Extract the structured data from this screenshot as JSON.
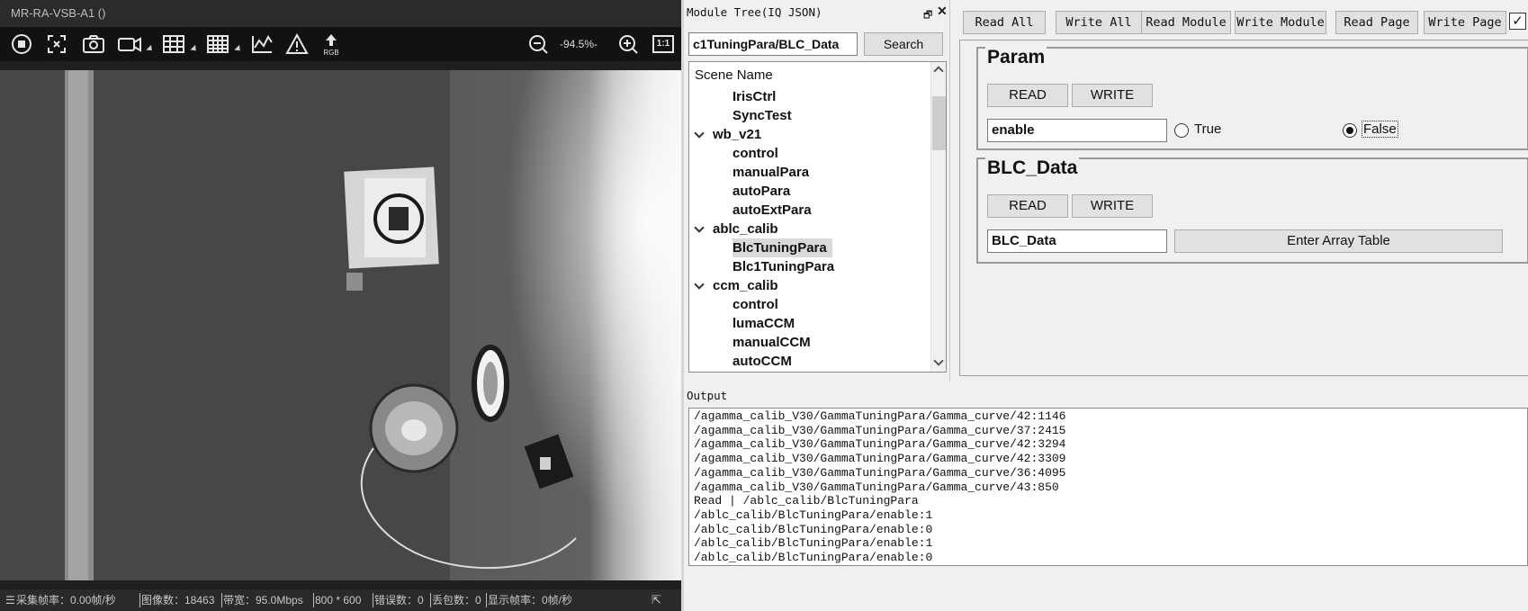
{
  "viewer": {
    "title": "MR-RA-VSB-A1 ()",
    "zoom_level": "-94.5%-",
    "toolbar_icons": [
      "stop-icon",
      "crop-icon",
      "camera-icon",
      "video-icon",
      "table-icon",
      "grid-icon",
      "chart-icon",
      "warning-icon",
      "rgb-icon",
      "zoom-out-icon",
      "zoom-in-icon",
      "actual-size-icon"
    ],
    "rgb_label": "RGB",
    "actual_size_label": "1:1",
    "status": {
      "capture_fps": "采集帧率：0.00帧/秒",
      "pixels": "图像数：18463",
      "bandwidth": "带宽：95.0Mbps",
      "resolution": "800 * 600",
      "errors": "错误数：0",
      "dropped": "丢包数：0",
      "display_fps": "显示帧率：0帧/秒"
    }
  },
  "module_tree": {
    "title": "Module Tree(IQ JSON)",
    "search_value": "c1TuningPara/BLC_Data",
    "search_label": "Search",
    "header": "Scene Name",
    "rows": [
      {
        "label": "IrisCtrl",
        "level": 2
      },
      {
        "label": "SyncTest",
        "level": 2
      },
      {
        "label": "wb_v21",
        "level": 1
      },
      {
        "label": "control",
        "level": 2
      },
      {
        "label": "manualPara",
        "level": 2
      },
      {
        "label": "autoPara",
        "level": 2
      },
      {
        "label": "autoExtPara",
        "level": 2
      },
      {
        "label": "ablc_calib",
        "level": 1
      },
      {
        "label": "BlcTuningPara",
        "level": 2,
        "selected": true
      },
      {
        "label": "Blc1TuningPara",
        "level": 2
      },
      {
        "label": "ccm_calib",
        "level": 1
      },
      {
        "label": "control",
        "level": 2
      },
      {
        "label": "lumaCCM",
        "level": 2
      },
      {
        "label": "manualCCM",
        "level": 2
      },
      {
        "label": "autoCCM",
        "level": 2
      }
    ]
  },
  "toolbar": {
    "read_all": "Read All",
    "write_all": "Write All",
    "read_module": "Read Module",
    "write_module": "Write Module",
    "read_page": "Read Page",
    "write_page": "Write Page",
    "check_mark": "✓"
  },
  "param_group": {
    "title": "Param",
    "read_label": "READ",
    "write_label": "WRITE",
    "field_value": "enable",
    "true_label": "True",
    "false_label": "False",
    "selected": "False"
  },
  "blc_group": {
    "title": "BLC_Data",
    "read_label": "READ",
    "write_label": "WRITE",
    "field_value": "BLC_Data",
    "array_button": "Enter Array Table"
  },
  "output": {
    "title": "Output",
    "lines": [
      "/agamma_calib_V30/GammaTuningPara/Gamma_curve/42:1146",
      "/agamma_calib_V30/GammaTuningPara/Gamma_curve/37:2415",
      "/agamma_calib_V30/GammaTuningPara/Gamma_curve/42:3294",
      "/agamma_calib_V30/GammaTuningPara/Gamma_curve/42:3309",
      "/agamma_calib_V30/GammaTuningPara/Gamma_curve/36:4095",
      "/agamma_calib_V30/GammaTuningPara/Gamma_curve/43:850",
      "Read | /ablc_calib/BlcTuningPara",
      "/ablc_calib/BlcTuningPara/enable:1",
      "/ablc_calib/BlcTuningPara/enable:0",
      "/ablc_calib/BlcTuningPara/enable:1",
      "/ablc_calib/BlcTuningPara/enable:0"
    ]
  }
}
